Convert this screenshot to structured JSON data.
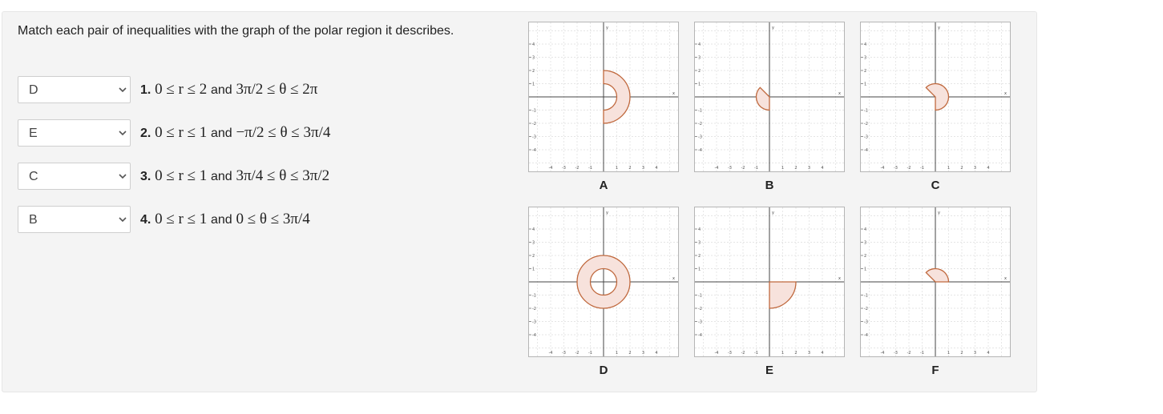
{
  "prompt": "Match each pair of inequalities with the graph of the polar region it describes.",
  "colors": {
    "region_fill": "#f7e2dc",
    "region_stroke": "#c0693e",
    "grid": "#dddddd",
    "axis": "#444444"
  },
  "icons": {
    "dropdown": "chevron-down-icon"
  },
  "matches": [
    {
      "selected": "D",
      "number": "1.",
      "lhs": "0 ≤ r ≤ 2",
      "conj": "and",
      "rhs": "3π/2 ≤ θ ≤ 2π"
    },
    {
      "selected": "E",
      "number": "2.",
      "lhs": "0 ≤ r ≤ 1",
      "conj": "and",
      "rhs": "−π/2 ≤ θ ≤ 3π/4"
    },
    {
      "selected": "C",
      "number": "3.",
      "lhs": "0 ≤ r ≤ 1",
      "conj": "and",
      "rhs": "3π/4 ≤ θ ≤ 3π/2"
    },
    {
      "selected": "B",
      "number": "4.",
      "lhs": "0 ≤ r ≤ 1",
      "conj": "and",
      "rhs": "0 ≤ θ ≤ 3π/4"
    }
  ],
  "axis": {
    "x_name": "x",
    "y_name": "y",
    "x_ticks": [
      "-4",
      "-3",
      "-2",
      "-1",
      "1",
      "2",
      "3",
      "4"
    ],
    "y_ticks": [
      "4",
      "3",
      "2",
      "1",
      "-1",
      "-2",
      "-3",
      "-4"
    ]
  },
  "graphs": [
    {
      "label": "A",
      "r_min": 1,
      "r_max": 2,
      "theta_start_deg": -90,
      "theta_end_deg": 90
    },
    {
      "label": "B",
      "r_min": 0,
      "r_max": 1,
      "theta_start_deg": 135,
      "theta_end_deg": 270
    },
    {
      "label": "C",
      "r_min": 0,
      "r_max": 1,
      "theta_start_deg": -90,
      "theta_end_deg": 135
    },
    {
      "label": "D",
      "r_min": 1,
      "r_max": 2,
      "theta_start_deg": 0,
      "theta_end_deg": 360
    },
    {
      "label": "E",
      "r_min": 0,
      "r_max": 2,
      "theta_start_deg": -90,
      "theta_end_deg": 0
    },
    {
      "label": "F",
      "r_min": 0,
      "r_max": 1,
      "theta_start_deg": 0,
      "theta_end_deg": 135
    }
  ]
}
